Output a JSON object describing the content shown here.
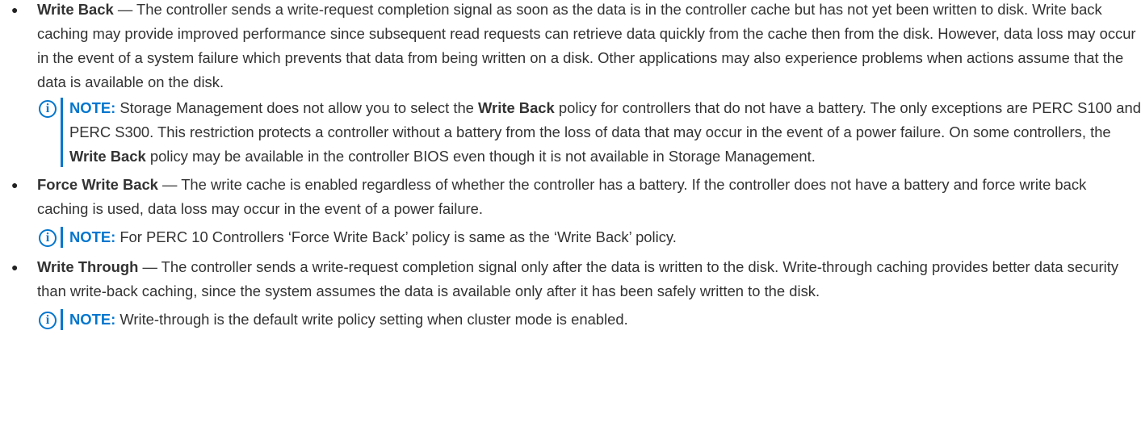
{
  "items": [
    {
      "bullet": "●",
      "term": "Write Back",
      "text": " — The controller sends a write-request completion signal as soon as the data is in the controller cache but has not yet been written to disk. Write back caching may provide improved performance since subsequent read requests can retrieve data quickly from the cache then from the disk. However, data loss may occur in the event of a system failure which prevents that data from being written on a disk. Other applications may also experience problems when actions assume that the data is available on the disk.",
      "note": {
        "label": "NOTE:",
        "part1": " Storage Management does not allow you to select the ",
        "bold1": "Write Back",
        "part2": " policy for controllers that do not have a battery. The only exceptions are PERC S100 and PERC S300. This restriction protects a controller without a battery from the loss of data that may occur in the event of a power failure. On some controllers, the ",
        "bold2": "Write Back",
        "part3": " policy may be available in the controller BIOS even though it is not available in Storage Management."
      }
    },
    {
      "bullet": "●",
      "term": "Force Write Back",
      "text": " — The write cache is enabled regardless of whether the controller has a battery. If the controller does not have a battery and force write back caching is used, data loss may occur in the event of a power failure.",
      "note": {
        "label": "NOTE:",
        "text": " For PERC 10 Controllers ‘Force Write Back’ policy is same as the ‘Write Back’ policy."
      }
    },
    {
      "bullet": "●",
      "term": "Write Through",
      "text": " — The controller sends a write-request completion signal only after the data is written to the disk. Write-through caching provides better data security than write-back caching, since the system assumes the data is available only after it has been safely written to the disk.",
      "note": {
        "label": "NOTE:",
        "text": " Write-through is the default write policy setting when cluster mode is enabled."
      }
    }
  ],
  "note_icon": {
    "name": "info-icon",
    "glyph": "i",
    "color": "#0076ce"
  }
}
